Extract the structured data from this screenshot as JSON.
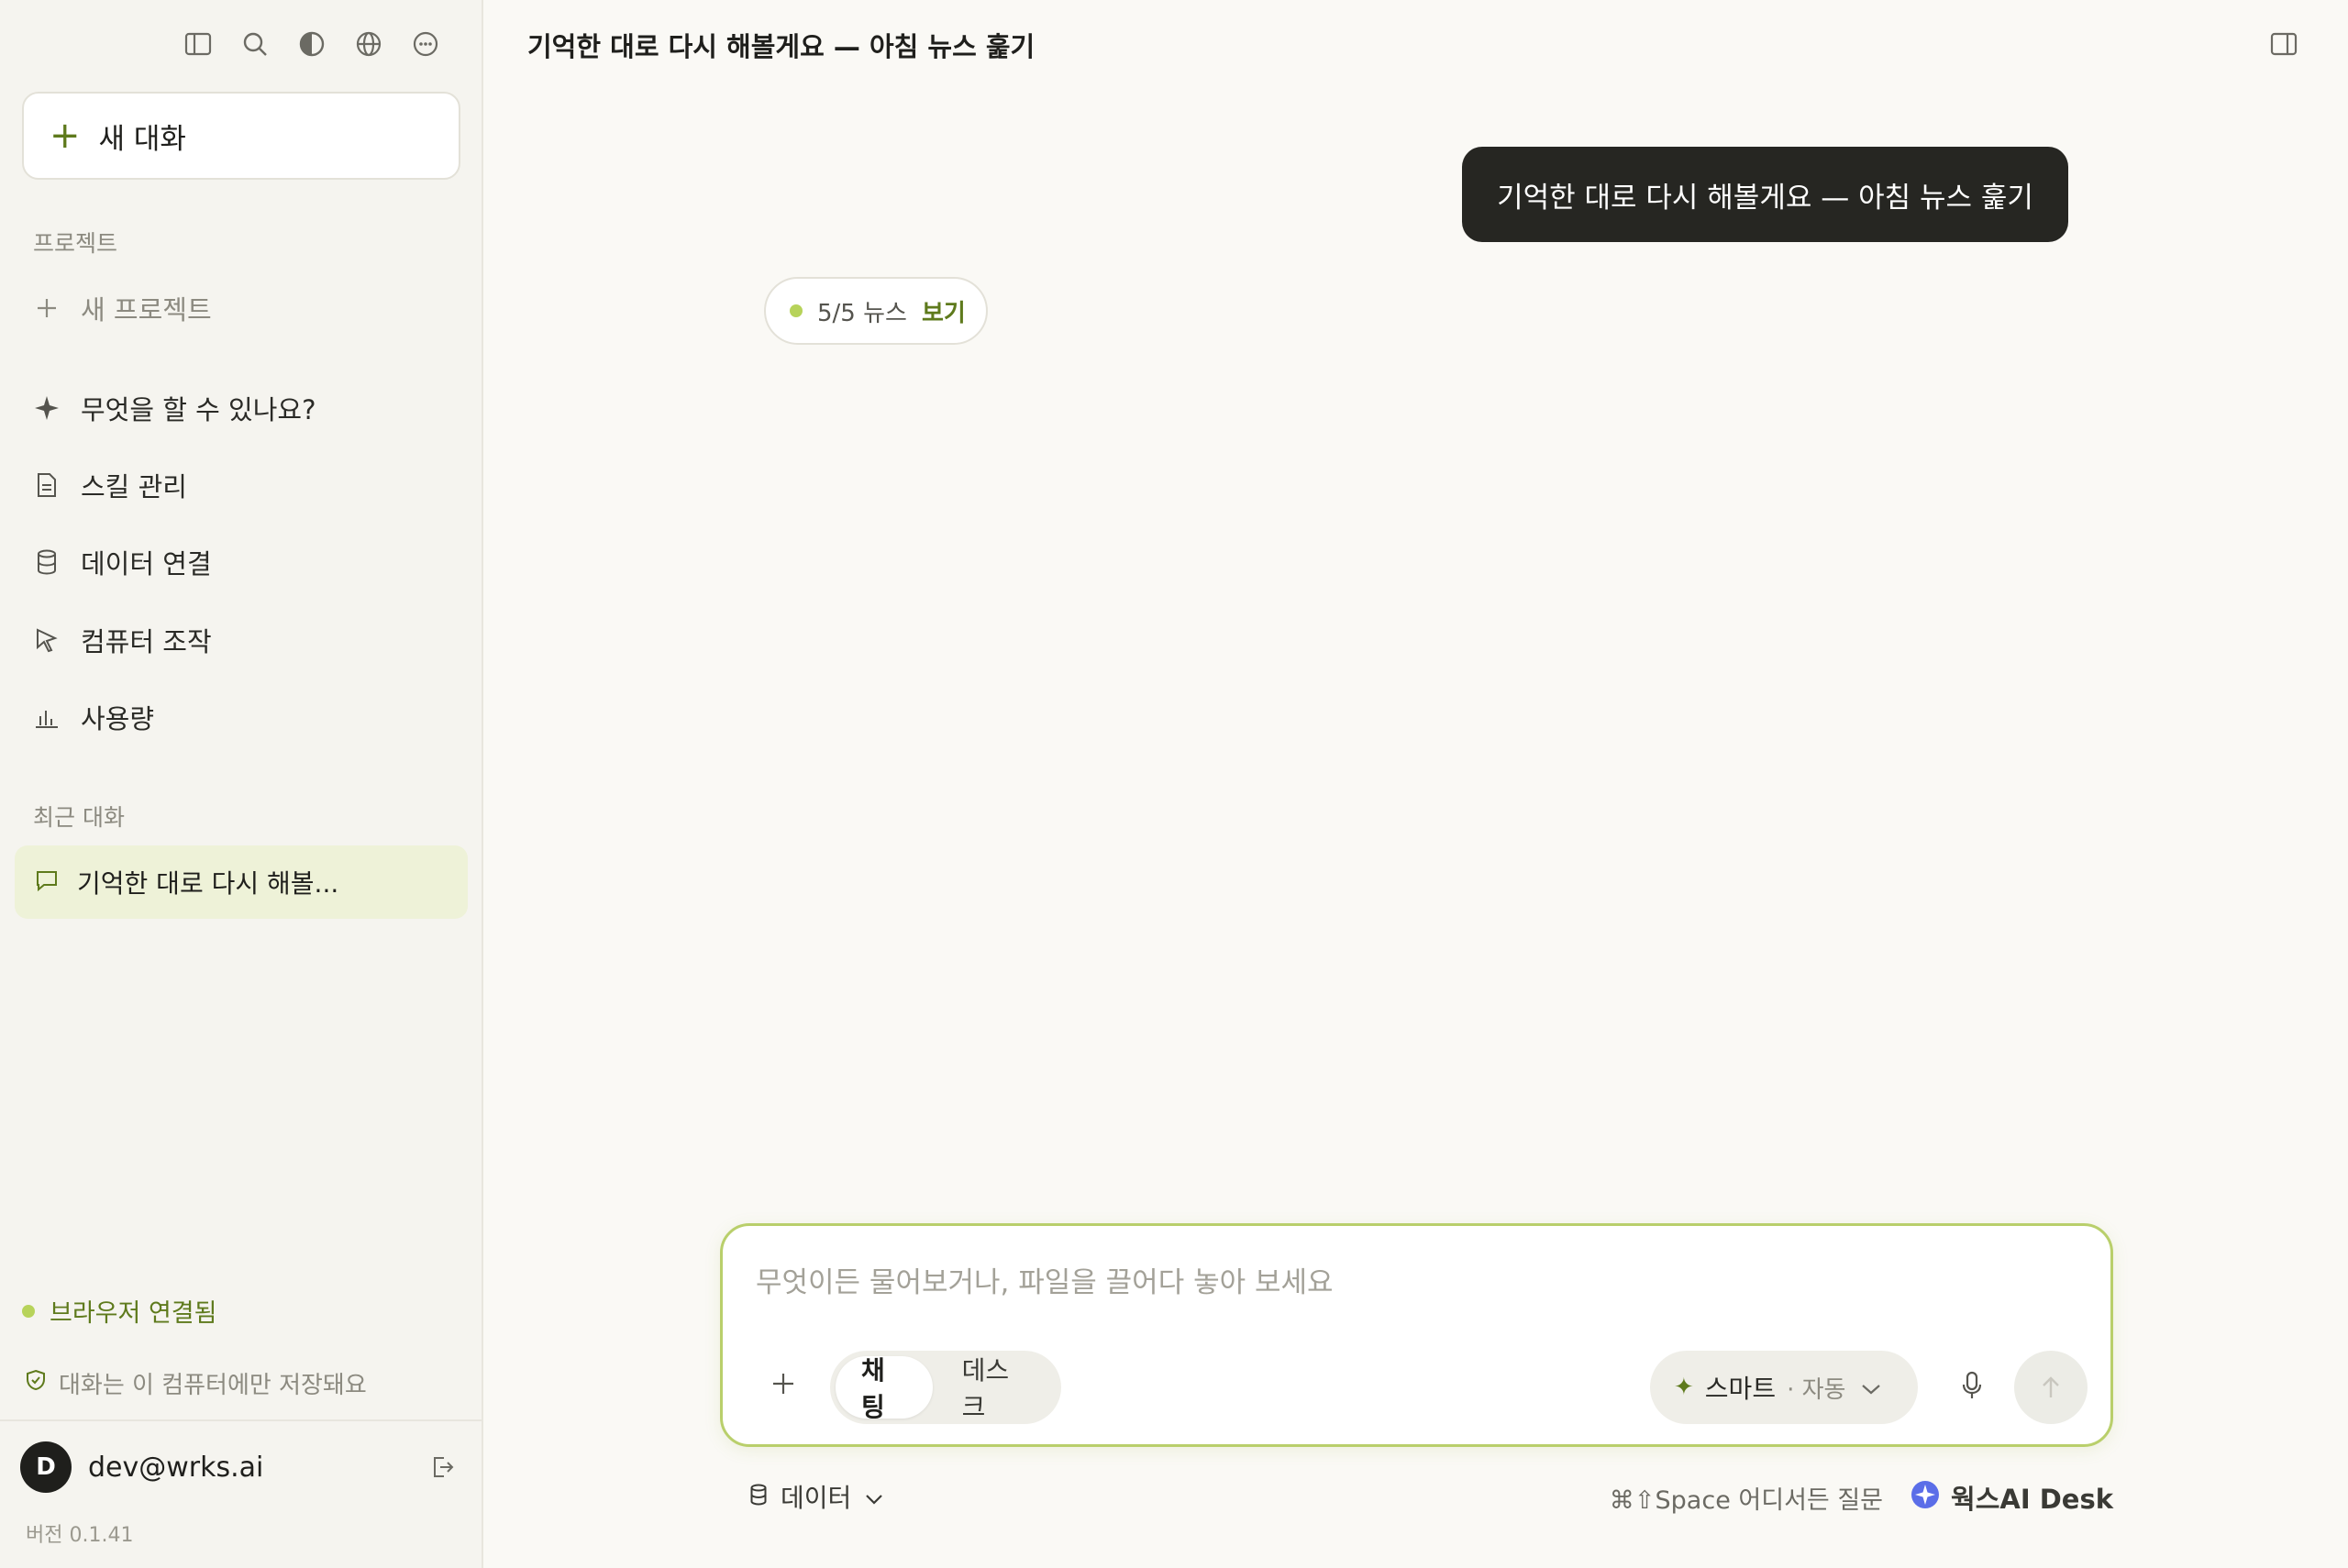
{
  "sidebar": {
    "new_chat_label": "새 대화",
    "projects_label": "프로젝트",
    "new_project_label": "새 프로젝트",
    "nav": [
      {
        "label": "무엇을 할 수 있나요?",
        "icon": "sparkle-icon"
      },
      {
        "label": "스킬 관리",
        "icon": "document-icon"
      },
      {
        "label": "데이터 연결",
        "icon": "database-icon"
      },
      {
        "label": "컴퓨터 조작",
        "icon": "cursor-icon"
      },
      {
        "label": "사용량",
        "icon": "bar-chart-icon"
      }
    ],
    "recent_label": "최근 대화",
    "recent_items": [
      {
        "label": "기억한 대로 다시 해볼..."
      }
    ],
    "browser_status": "브라우저 연결됨",
    "privacy_note": "대화는 이 컴퓨터에만 저장돼요",
    "user": {
      "initial": "D",
      "email": "dev@wrks.ai"
    },
    "version": "버전 0.1.41"
  },
  "main": {
    "title": "기억한 대로 다시 해볼게요 — 아침 뉴스 훑기",
    "user_message": "기억한 대로 다시 해볼게요 — 아침 뉴스 훑기",
    "news_chip": {
      "count": "5/5 뉴스",
      "action": "보기"
    },
    "composer": {
      "placeholder": "무엇이든 물어보거나, 파일을 끌어다 놓아 보세요",
      "modes": [
        "채팅",
        "데스크"
      ],
      "active_mode": "채팅",
      "model_name": "스마트",
      "model_sub": "· 자동"
    },
    "footer": {
      "data_label": "데이터",
      "shortcut_hint": "⌘⇧Space 어디서든 질문",
      "brand": "웍스AI Desk"
    }
  },
  "colors": {
    "accent": "#5e7a1c",
    "accent_dot": "#b7d35a",
    "bubble_bg": "#262622",
    "selected_bg": "#eef2d8"
  }
}
